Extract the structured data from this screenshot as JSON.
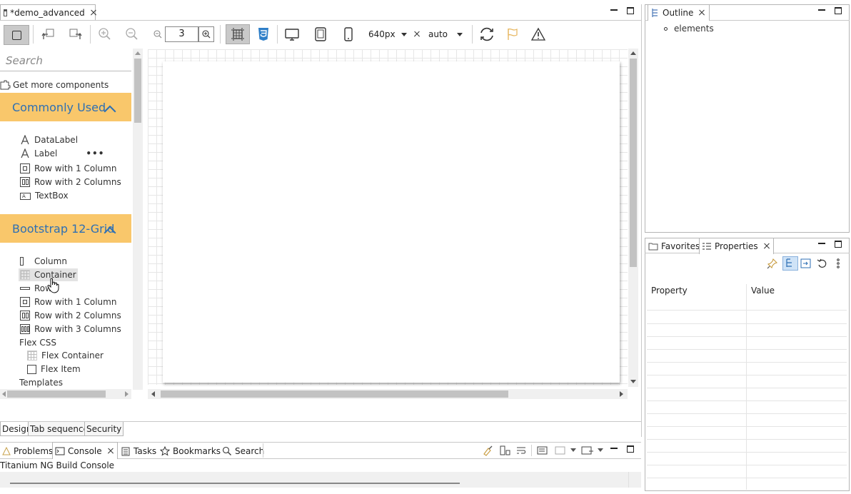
{
  "editor": {
    "tab_title": "*demo_advanced",
    "zoom_value": "3",
    "width_value": "640px",
    "height_value": "auto"
  },
  "palette": {
    "search_placeholder": "Search",
    "get_more_label": "Get more components",
    "sections": [
      {
        "title": "Commonly Used",
        "items": [
          "DataLabel",
          "Label",
          "Row with 1 Column",
          "Row with 2 Columns",
          "TextBox"
        ]
      },
      {
        "title": "Bootstrap 12-Grid",
        "items": [
          "Column",
          "Container",
          "Row",
          "Row with 1 Column",
          "Row with 2 Columns",
          "Row with 3 Columns",
          "Flex CSS",
          "Flex Container",
          "Flex Item",
          "Templates"
        ]
      }
    ]
  },
  "design_tabs": [
    "Design",
    "Tab sequence",
    "Security"
  ],
  "console_tabs": {
    "items": [
      "Problems",
      "Console",
      "Tasks",
      "Bookmarks",
      "Search"
    ],
    "console_text": "Titanium NG Build Console"
  },
  "outline": {
    "tab_title": "Outline",
    "root_item": "elements"
  },
  "properties": {
    "tabs": [
      "Favorites",
      "Properties"
    ],
    "col_property": "Property",
    "col_value": "Value"
  }
}
